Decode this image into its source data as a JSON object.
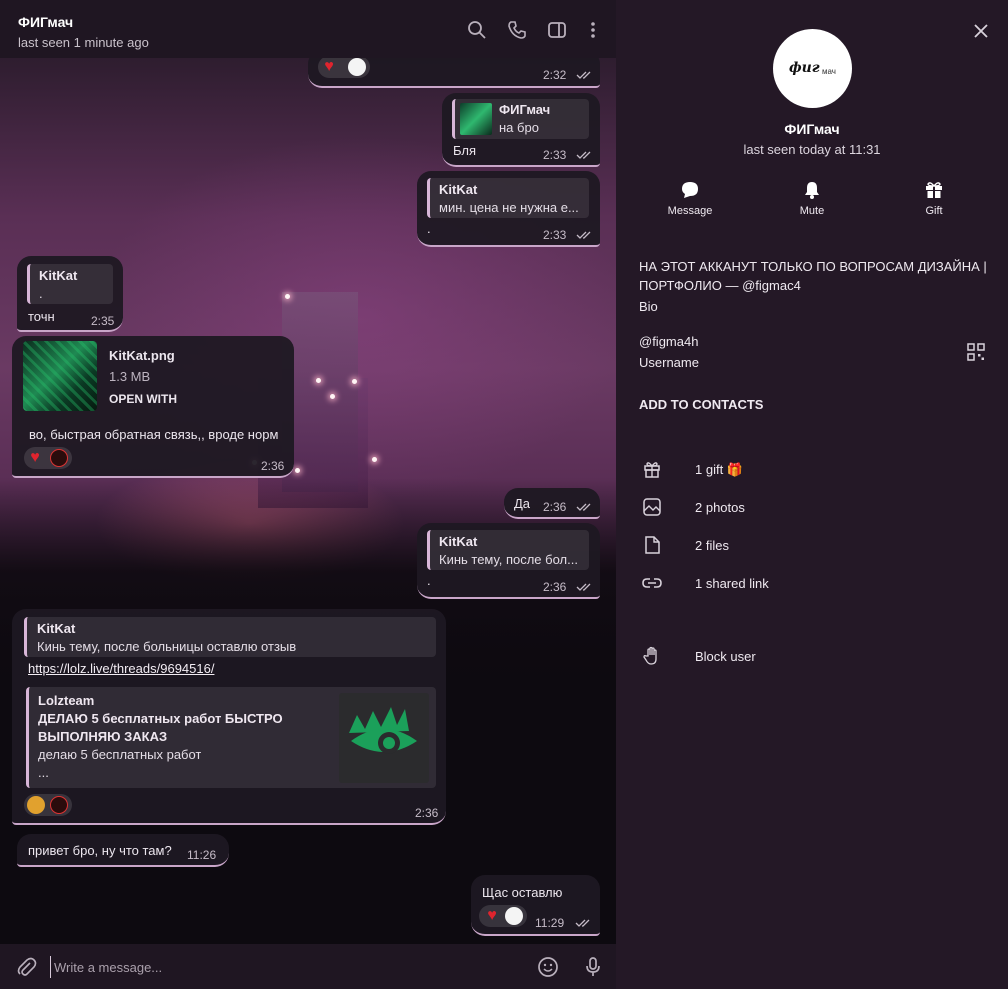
{
  "chat": {
    "title": "ФИГмач",
    "status": "last seen 1 minute ago",
    "composer_placeholder": "Write a message...",
    "messages": {
      "m1": {
        "time": "2:32"
      },
      "m2": {
        "reply_name": "ФИГмач",
        "reply_text": "на бро",
        "text": "Бля",
        "time": "2:33"
      },
      "m3": {
        "reply_name": "KitKat",
        "reply_text": "мин. цена не нужна е...",
        "text": ".",
        "time": "2:33"
      },
      "m4": {
        "reply_name": "KitKat",
        "reply_text": ".",
        "text": "точн",
        "time": "2:35"
      },
      "m5": {
        "file_name": "KitKat.png",
        "file_size": "1.3 MB",
        "file_action": "OPEN WITH",
        "text": "во, быстрая обратная связь,, вроде норм",
        "time": "2:36"
      },
      "m6": {
        "text": "Да",
        "time": "2:36"
      },
      "m7": {
        "reply_name": "KitKat",
        "reply_text": "Кинь тему, после бол...",
        "text": ".",
        "time": "2:36"
      },
      "m8": {
        "reply_name": "KitKat",
        "reply_text": "Кинь тему, после больницы оставлю отзыв",
        "link": "https://lolz.live/threads/9694516/",
        "preview_site": "Lolzteam",
        "preview_title_1": "ДЕЛАЮ 5 бесплатных работ  БЫСТРО",
        "preview_title_2": "ВЫПОЛНЯЮ ЗАКАЗ",
        "preview_desc": "делаю 5 бесплатных работ",
        "preview_more": "...",
        "time": "2:36"
      },
      "m9": {
        "text": "привет бро, ну что там?",
        "time": "11:26"
      },
      "m10": {
        "text": "Щас оставлю",
        "time": "11:29"
      }
    }
  },
  "profile": {
    "avatar_text": "фиг",
    "avatar_sub": "мач",
    "name": "ФИГмач",
    "status": "last seen today at 11:31",
    "actions": [
      {
        "label": "Message"
      },
      {
        "label": "Mute"
      },
      {
        "label": "Gift"
      }
    ],
    "bio_line_1": "НА ЭТОТ АККАНУТ ТОЛЬКО ПО ВОПРОСАМ ДИЗАЙНА |",
    "bio_line_2": "ПОРТФОЛИО — @figmac4",
    "bio_label": "Bio",
    "username": "@figma4h",
    "username_label": "Username",
    "add_contacts": "ADD TO CONTACTS",
    "rows": [
      {
        "label": "1 gift 🎁"
      },
      {
        "label": "2 photos"
      },
      {
        "label": "2 files"
      },
      {
        "label": "1 shared link"
      },
      {
        "label": "Block user"
      }
    ]
  },
  "colors": {
    "background": "#241826",
    "bubble": "#1e1822",
    "accent_border": "#c9a6c9",
    "link": "#ffffff",
    "reaction_heart": "#e0242e"
  },
  "icons": [
    "search-icon",
    "phone-icon",
    "sidebar-icon",
    "more-icon",
    "close-icon",
    "attach-icon",
    "emoji-icon",
    "mic-icon",
    "message-icon",
    "bell-icon",
    "gift-icon",
    "photo-icon",
    "file-icon",
    "link-icon",
    "hand-icon",
    "qr-icon"
  ]
}
